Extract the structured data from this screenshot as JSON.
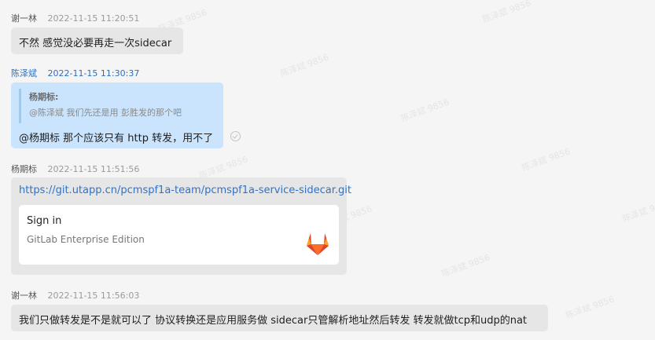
{
  "watermark": "陈泽斌 9856",
  "colors": {
    "background": "#f5f5f5",
    "bubble_gray": "#e6e6e6",
    "bubble_blue": "#c9e4fc",
    "self_name": "#2d6fb8",
    "link": "#2f73c9"
  },
  "messages": [
    {
      "sender": "谢一林",
      "timestamp": "2022-11-15 11:20:51",
      "text": "不然   感觉没必要再走一次sidecar"
    },
    {
      "sender": "陈泽斌",
      "timestamp": "2022-11-15 11:30:37",
      "quote": {
        "author": "杨期标:",
        "text": "@陈泽斌  我们先还是用  彭胜发的那个吧"
      },
      "text": "@杨期标  那个应该只有 http 转发，用不了",
      "status_icon": "read-check-icon"
    },
    {
      "sender": "杨期标",
      "timestamp": "2022-11-15 11:51:56",
      "link": "https://git.utapp.cn/pcmspf1a-team/pcmspf1a-service-sidecar.git",
      "card": {
        "title": "Sign in",
        "subtitle": "GitLab Enterprise Edition",
        "icon": "gitlab-logo-icon"
      }
    },
    {
      "sender": "谢一林",
      "timestamp": "2022-11-15 11:56:03",
      "text": "我们只做转发是不是就可以了   协议转换还是应用服务做   sidecar只管解析地址然后转发   转发就做tcp和udp的nat"
    }
  ]
}
